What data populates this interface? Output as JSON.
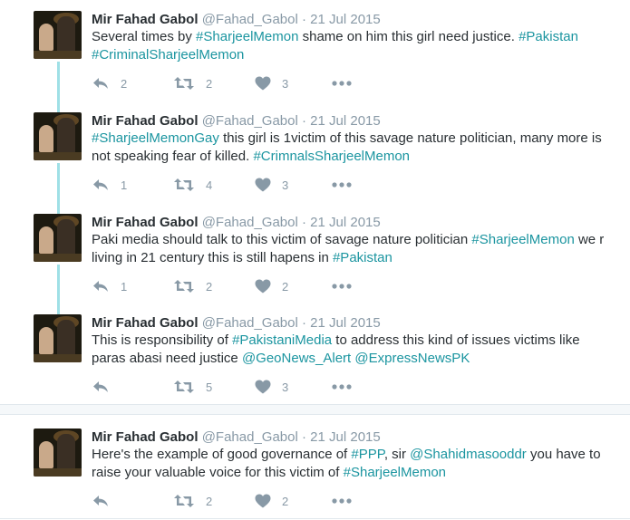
{
  "tweets": [
    {
      "name": "Mir Fahad Gabol",
      "handle": "@Fahad_Gabol",
      "separator": "·",
      "date": "21 Jul 2015",
      "segments": [
        {
          "t": "text",
          "v": "Several times by "
        },
        {
          "t": "hashtag",
          "v": "#SharjeelMemon"
        },
        {
          "t": "text",
          "v": " shame on him this girl need justice. "
        },
        {
          "t": "hashtag",
          "v": "#Pakistan"
        },
        {
          "t": "text",
          "v": " "
        },
        {
          "t": "hashtag",
          "v": "#CriminalSharjeelMemon"
        }
      ],
      "replies": "2",
      "retweets": "2",
      "likes": "3"
    },
    {
      "name": "Mir Fahad Gabol",
      "handle": "@Fahad_Gabol",
      "separator": "·",
      "date": "21 Jul 2015",
      "segments": [
        {
          "t": "hashtag",
          "v": "#SharjeelMemonGay"
        },
        {
          "t": "text",
          "v": " this girl is 1victim of this savage nature politician, many more is not speaking fear of killed.  "
        },
        {
          "t": "hashtag",
          "v": "#CrimnalsSharjeelMemon"
        }
      ],
      "replies": "1",
      "retweets": "4",
      "likes": "3"
    },
    {
      "name": "Mir Fahad Gabol",
      "handle": "@Fahad_Gabol",
      "separator": "·",
      "date": "21 Jul 2015",
      "segments": [
        {
          "t": "text",
          "v": "Paki media should talk to this victim of savage nature politician "
        },
        {
          "t": "hashtag",
          "v": "#SharjeelMemon"
        },
        {
          "t": "text",
          "v": " we r living in 21 century this is still hapens in "
        },
        {
          "t": "hashtag",
          "v": "#Pakistan"
        }
      ],
      "replies": "1",
      "retweets": "2",
      "likes": "2"
    },
    {
      "name": "Mir Fahad Gabol",
      "handle": "@Fahad_Gabol",
      "separator": "·",
      "date": "21 Jul 2015",
      "segments": [
        {
          "t": "text",
          "v": "This is responsibility of "
        },
        {
          "t": "hashtag",
          "v": "#PakistaniMedia"
        },
        {
          "t": "text",
          "v": " to address this kind of issues victims like paras abasi need justice "
        },
        {
          "t": "mention",
          "v": "@GeoNews_Alert"
        },
        {
          "t": "text",
          "v": " "
        },
        {
          "t": "mention",
          "v": "@ExpressNewsPK"
        }
      ],
      "replies": "",
      "retweets": "5",
      "likes": "3"
    },
    {
      "name": "Mir Fahad Gabol",
      "handle": "@Fahad_Gabol",
      "separator": "·",
      "date": "21 Jul 2015",
      "segments": [
        {
          "t": "text",
          "v": "Here's the example of good governance of "
        },
        {
          "t": "hashtag",
          "v": "#PPP"
        },
        {
          "t": "text",
          "v": ", sir "
        },
        {
          "t": "mention",
          "v": "@Shahidmasooddr"
        },
        {
          "t": "text",
          "v": " you have to raise your valuable voice for this victim of "
        },
        {
          "t": "hashtag",
          "v": "#SharjeelMemon"
        }
      ],
      "replies": "",
      "retweets": "2",
      "likes": "2"
    }
  ],
  "colors": {
    "link": "#1b95a0",
    "muted": "#8899a6",
    "text": "#292f33",
    "thread_line": "#9fe0e6"
  },
  "icons": {
    "reply": "reply-icon",
    "retweet": "retweet-icon",
    "like": "heart-icon",
    "more": "more-dots-icon"
  }
}
